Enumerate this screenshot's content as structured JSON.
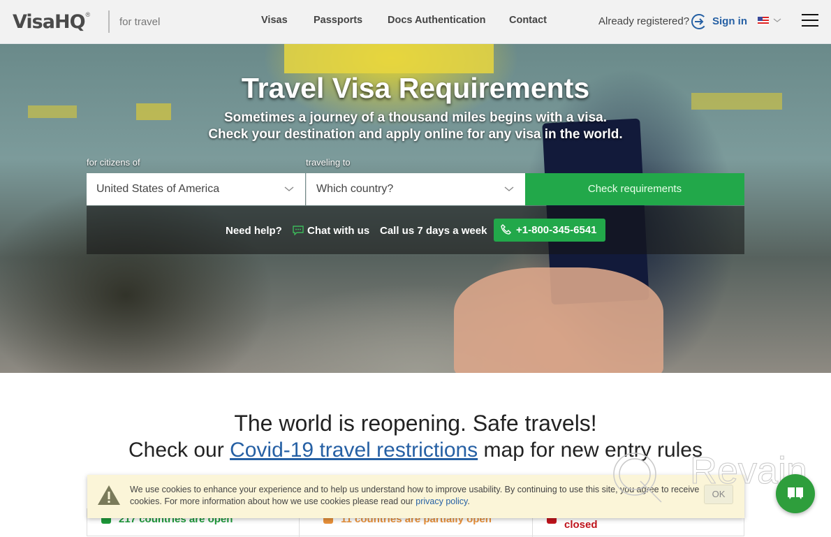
{
  "header": {
    "logo_text": "VisaHQ",
    "logo_reg": "®",
    "tagline": "for travel",
    "nav": [
      "Visas",
      "Passports",
      "Docs Authentication",
      "Contact"
    ],
    "already_registered": "Already registered?",
    "sign_in": "Sign in",
    "language_flag": "us-flag-icon"
  },
  "hero": {
    "title": "Travel Visa Requirements",
    "subtitle_1": "Sometimes a journey of a thousand miles begins with a visa.",
    "subtitle_2": "Check your destination and apply online for any visa in the world.",
    "citizens_label": "for citizens of",
    "citizens_value": "United States of America",
    "traveling_label": "traveling to",
    "traveling_placeholder": "Which country?",
    "check_button": "Check requirements",
    "need_help": "Need help?",
    "chat": "Chat with us",
    "call": "Call us 7 days a week",
    "phone": "+1-800-345-6541"
  },
  "covid": {
    "headline": "The world is reopening. Safe travels!",
    "check_prefix": "Check our",
    "link": "Covid-19 travel restrictions",
    "check_suffix": "map for new entry rules"
  },
  "stats": [
    {
      "label": "217 countries are open",
      "color": "#1e9a3a"
    },
    {
      "label": "11 countries are partially open",
      "color": "#e8913a"
    },
    {
      "label": "closed",
      "color": "#c0141c"
    }
  ],
  "cookie": {
    "text": "We use cookies to enhance your experience and to help us understand how to improve usability. By continuing to use this site, you agree to receive cookies. For more information about how we use cookies please read our ",
    "link": "privacy policy",
    "end": ".",
    "ok": "OK"
  },
  "watermark": "Revain",
  "colors": {
    "brand_green": "#22a84a",
    "link_blue": "#2660a4"
  }
}
